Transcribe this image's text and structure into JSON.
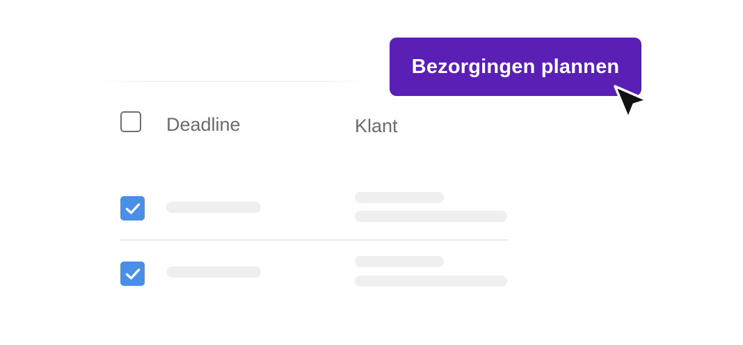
{
  "table": {
    "columns": {
      "deadline": "Deadline",
      "klant": "Klant"
    },
    "rows": [
      {
        "selected": true
      },
      {
        "selected": true
      }
    ]
  },
  "action": {
    "label": "Bezorgingen plannen",
    "color": "#5a1fb5"
  },
  "colors": {
    "checkbox_checked": "#4a8fe7",
    "skeleton": "#efefef",
    "header_text": "#6b6b6b"
  },
  "icons": {
    "cursor": "mouse-pointer-icon",
    "check": "checkmark-icon"
  }
}
